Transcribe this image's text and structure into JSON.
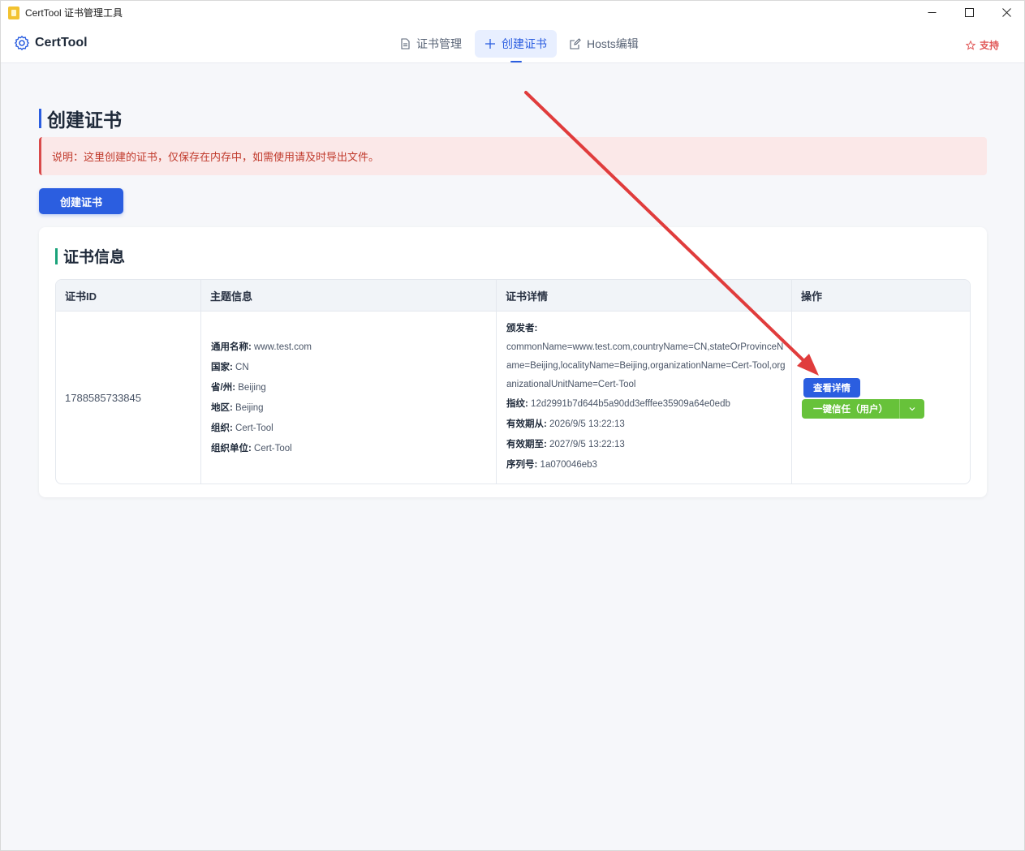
{
  "window": {
    "title": "CertTool 证书管理工具"
  },
  "header": {
    "brand": "CertTool",
    "nav": [
      {
        "label": "证书管理",
        "icon": "document-icon"
      },
      {
        "label": "创建证书",
        "icon": "plus-icon",
        "active": true
      },
      {
        "label": "Hosts编辑",
        "icon": "edit-icon"
      }
    ],
    "support": "支持"
  },
  "main": {
    "title": "创建证书",
    "notice": "说明：这里创建的证书，仅保存在内存中，如需使用请及时导出文件。",
    "create_button": "创建证书",
    "section_title": "证书信息",
    "table": {
      "columns": [
        "证书ID",
        "主题信息",
        "证书详情",
        "操作"
      ],
      "rows": [
        {
          "id": "1788585733845",
          "subject": [
            {
              "label": "通用名称:",
              "value": "www.test.com"
            },
            {
              "label": "国家:",
              "value": "CN"
            },
            {
              "label": "省/州:",
              "value": "Beijing"
            },
            {
              "label": "地区:",
              "value": "Beijing"
            },
            {
              "label": "组织:",
              "value": "Cert-Tool"
            },
            {
              "label": "组织单位:",
              "value": "Cert-Tool"
            }
          ],
          "details": {
            "issuer_label": "颁发者:",
            "issuer_value": "commonName=www.test.com,countryName=CN,stateOrProvinceName=Beijing,localityName=Beijing,organizationName=Cert-Tool,organizationalUnitName=Cert-Tool",
            "fields": [
              {
                "label": "指纹:",
                "value": "12d2991b7d644b5a90dd3efffee35909a64e0edb"
              },
              {
                "label": "有效期从:",
                "value": "2026/9/5 13:22:13"
              },
              {
                "label": "有效期至:",
                "value": "2027/9/5 13:22:13"
              },
              {
                "label": "序列号:",
                "value": "1a070046eb3"
              }
            ]
          },
          "actions": {
            "view": "查看详情",
            "trust": "一键信任（用户）"
          }
        }
      ]
    }
  },
  "colors": {
    "primary": "#2b5ee0",
    "success": "#67c23a",
    "danger": "#d94a4a",
    "annotation_arrow": "#e03c3c"
  }
}
